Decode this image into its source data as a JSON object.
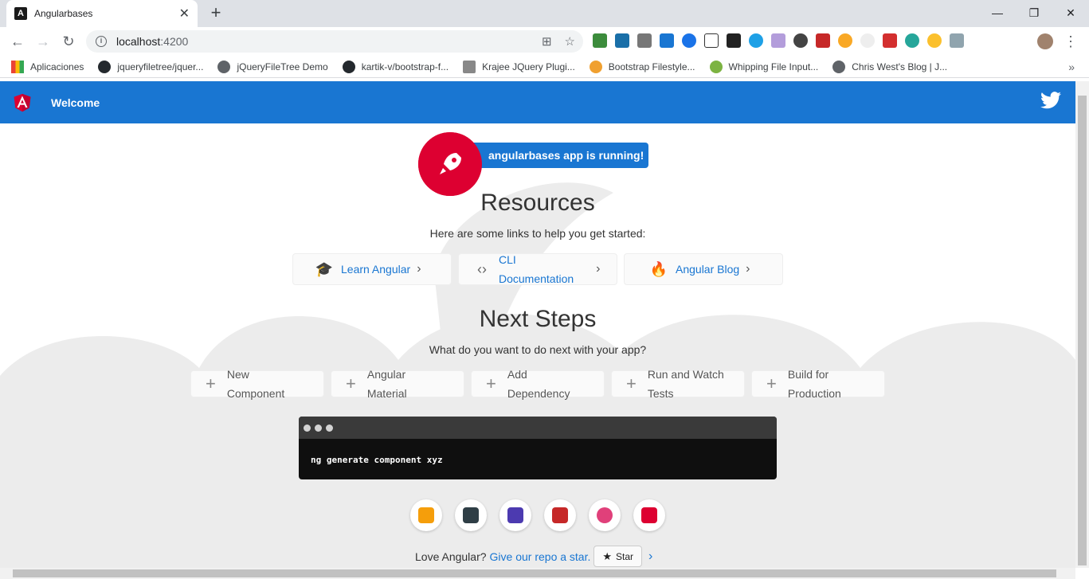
{
  "browser": {
    "tab_title": "Angularbases",
    "new_tab": "+",
    "url_host": "localhost",
    "url_port": ":4200",
    "bookmarks": [
      {
        "label": "Aplicaciones",
        "color": "#e8710a"
      },
      {
        "label": "jqueryfiletree/jquer...",
        "color": "#24292e"
      },
      {
        "label": "jQueryFileTree Demo",
        "color": "#5f6368"
      },
      {
        "label": "kartik-v/bootstrap-f...",
        "color": "#24292e"
      },
      {
        "label": "Krajee JQuery Plugi...",
        "color": "#888888"
      },
      {
        "label": "Bootstrap Filestyle...",
        "color": "#f0a030"
      },
      {
        "label": "Whipping File Input...",
        "color": "#7cb342"
      },
      {
        "label": "Chris West's Blog | J...",
        "color": "#5f6368"
      }
    ]
  },
  "header": {
    "title": "Welcome"
  },
  "hero": {
    "running": "angularbases app is running!"
  },
  "resources": {
    "title": "Resources",
    "subtitle": "Here are some links to help you get started:",
    "cards": [
      {
        "label": "Learn Angular",
        "icon": "graduation-cap-icon"
      },
      {
        "label": "CLI\nDocumentation",
        "icon": "code-icon"
      },
      {
        "label": "Angular Blog",
        "icon": "flame-icon"
      }
    ]
  },
  "next_steps": {
    "title": "Next Steps",
    "subtitle": "What do you want to do next with your app?",
    "steps": [
      "New Component",
      "Angular Material",
      "Add Dependency",
      "Run and Watch Tests",
      "Build for Production"
    ]
  },
  "terminal": {
    "command": "ng generate component xyz"
  },
  "footer": {
    "love_text": "Love Angular?",
    "repo_link": "Give our repo a star.",
    "star_label": "Star"
  },
  "colors": {
    "angular_red": "#dd0031",
    "toolbar_blue": "#1976d2"
  }
}
